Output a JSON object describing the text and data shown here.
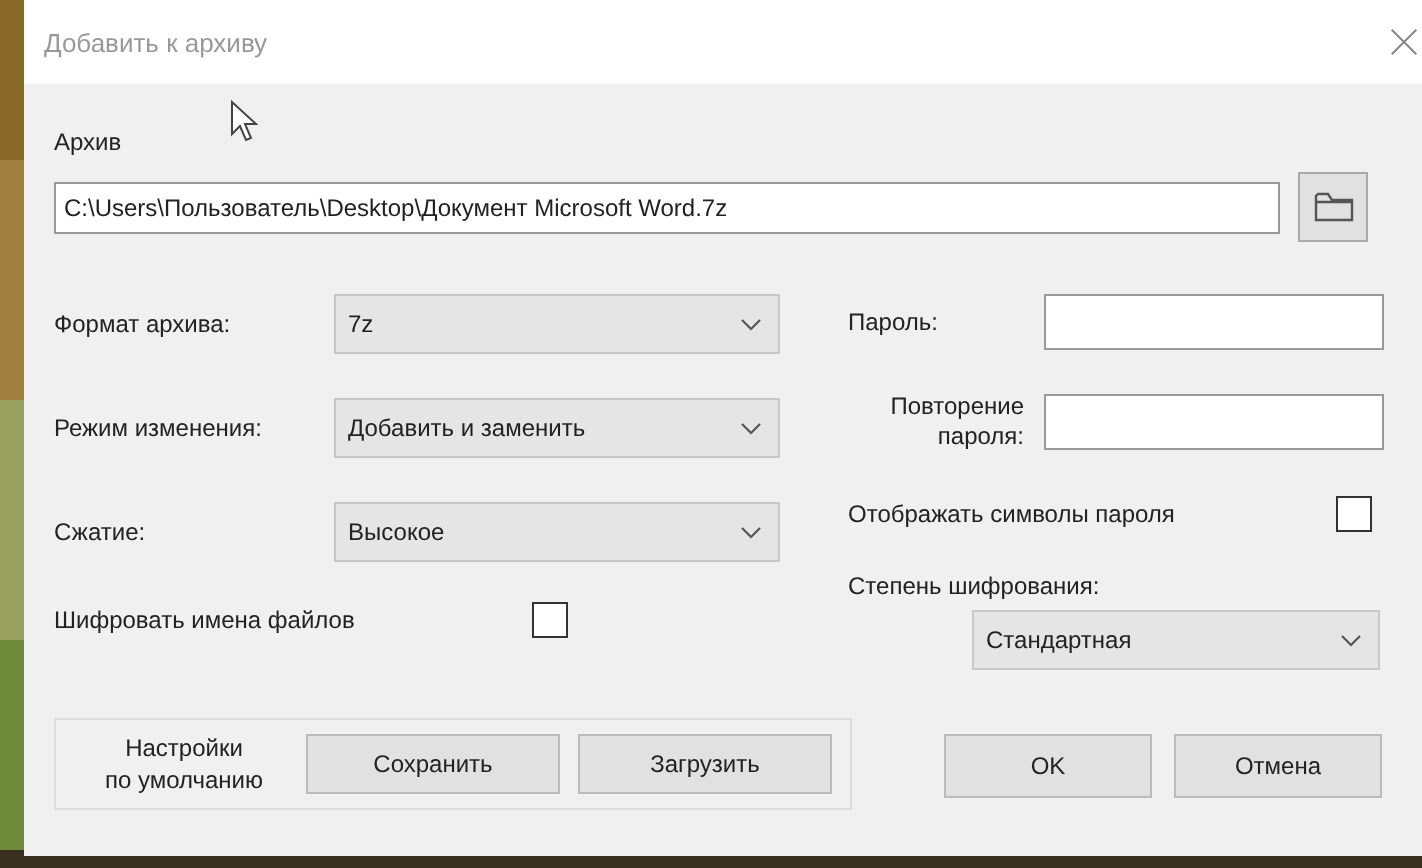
{
  "window": {
    "title": "Добавить к архиву"
  },
  "archive": {
    "label": "Архив",
    "path": "C:\\Users\\Пользователь\\Desktop\\Документ Microsoft Word.7z"
  },
  "left_options": [
    {
      "kind": "dropdown",
      "label": "Формат архива:",
      "value": "7z"
    },
    {
      "kind": "dropdown",
      "label": "Режим изменения:",
      "value": "Добавить и заменить"
    },
    {
      "kind": "dropdown",
      "label": "Сжатие:",
      "value": "Высокое"
    },
    {
      "kind": "checkbox",
      "label": "Шифровать имена файлов",
      "checked": false
    }
  ],
  "password": {
    "label": "Пароль:",
    "repeat_label_lines": [
      "Повторение",
      "пароля:"
    ],
    "show_label": "Отображать символы пароля",
    "show_checked": false,
    "method_label": "Степень шифрования:",
    "method_value": "Стандартная"
  },
  "defaults": {
    "label_lines": [
      "Настройки",
      "по умолчанию"
    ],
    "buttons": [
      "Сохранить",
      "Загрузить"
    ]
  },
  "buttons": [
    "OK",
    "Отмена"
  ]
}
